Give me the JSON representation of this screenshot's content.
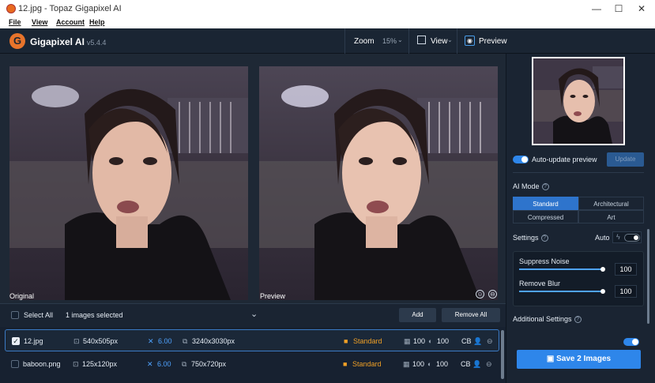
{
  "window": {
    "title": "12.jpg - Topaz Gigapixel AI",
    "minimize": "—",
    "maximize": "☐",
    "close": "✕"
  },
  "menu": [
    "File",
    "View",
    "Account",
    "Help"
  ],
  "header": {
    "logo_letter": "G",
    "app_name": "Gigapixel AI",
    "version": "v5.4.4",
    "zoom_label": "Zoom",
    "zoom_value": "15%",
    "view_label": "View",
    "preview_label": "Preview"
  },
  "panes": {
    "original_label": "Original",
    "preview_label": "Preview"
  },
  "selection": {
    "select_all": "Select All",
    "selected_count": "1 images selected",
    "add": "Add",
    "remove_all": "Remove All"
  },
  "images": [
    {
      "name": "12.jpg",
      "checked": true,
      "input_size": "540x505px",
      "scale": "6.00",
      "output_size": "3240x3030px",
      "mode": "Standard",
      "noise": "100",
      "blur": "100",
      "flags": "CB"
    },
    {
      "name": "baboon.png",
      "checked": false,
      "input_size": "125x120px",
      "scale": "6.00",
      "output_size": "750x720px",
      "mode": "Standard",
      "noise": "100",
      "blur": "100",
      "flags": "CB"
    }
  ],
  "right": {
    "auto_update": "Auto-update preview",
    "update_btn": "Update",
    "ai_mode_label": "AI Mode",
    "modes": [
      "Standard",
      "Architectural",
      "Compressed",
      "Art"
    ],
    "active_mode": "Standard",
    "settings_label": "Settings",
    "auto_label": "Auto",
    "suppress_noise_label": "Suppress Noise",
    "suppress_noise_value": "100",
    "remove_blur_label": "Remove Blur",
    "remove_blur_value": "100",
    "additional_settings": "Additional Settings",
    "save_btn": "Save 2 Images"
  },
  "colors": {
    "accent": "#2e86ea",
    "bg": "#1a2432",
    "mode_orange": "#f0a026"
  }
}
